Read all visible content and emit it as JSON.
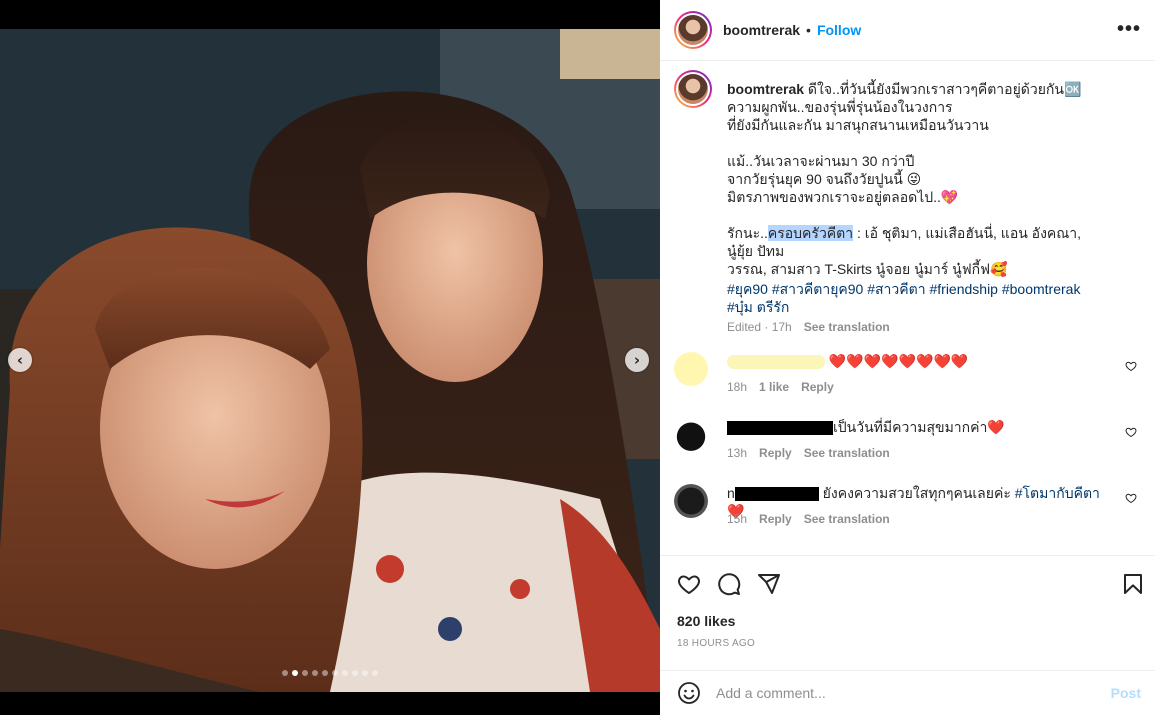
{
  "post": {
    "username": "boomtrerak",
    "separator": "•",
    "follow_label": "Follow",
    "more_label": "•••"
  },
  "media": {
    "prev_label": "‹",
    "next_label": "›",
    "carousel_count": 10,
    "carousel_active_index": 1
  },
  "caption": {
    "username": "boomtrerak",
    "line1": "ดีใจ..ที่วันนี้ยังมีพวกเราสาวๆคีตาอยู่ด้วยกัน🆗",
    "line2": "ความผูกพัน..ของรุ่นพี่รุ่นน้องในวงการ",
    "line3": "ที่ยังมีกันและกัน มาสนุกสนานเหมือนวันวาน",
    "line4": "แม้..วันเวลาจะผ่านมา 30 กว่าปี",
    "line5": "จากวัยรุ่นยุค 90 จนถึงวัยปูนนี้ 😜",
    "line6": "มิตรภาพของพวกเราจะอยู่ตลอดไป..💖",
    "line7_prefix": "รักนะ..",
    "line7_highlight": "ครอบครัวคีตา",
    "line7_suffix": " : เอ้ ชุติมา, แม่เสือฮันนี่, แอน อังคณา, นู๋ยุ้ย ปัทม",
    "line8": "วรรณ, สามสาว T-Skirts นู๋จอย นู๋มาร์ นู๋ฟกี้ฟ🥰",
    "hashtags": "#ยุค90 #สาวคีตายุค90 #สาวคีตา #friendship #boomtrerak #บุ๋ม ตรีรัก",
    "edited": "Edited · 17h",
    "see_translation": "See translation"
  },
  "comments": [
    {
      "text": "❤️❤️❤️❤️❤️❤️❤️❤️",
      "time": "18h",
      "likes": "1 like",
      "reply": "Reply"
    },
    {
      "text": "เป็นวันที่มีความสุขมากค่า❤️",
      "time": "13h",
      "reply": "Reply",
      "see_translation": "See translation"
    },
    {
      "name_initial": "n",
      "text": " ยังคงความสวยใสทุกๆคนเลยค่ะ ",
      "tag": "#โตมากับคีตา",
      "tail": "❤️",
      "time": "15h",
      "reply": "Reply",
      "see_translation": "See translation"
    }
  ],
  "stats": {
    "likes": "820 likes",
    "time_ago": "18 HOURS AGO"
  },
  "add_comment": {
    "placeholder": "Add a comment...",
    "post_label": "Post"
  },
  "colors": {
    "accent": "#0095f6",
    "hashtag": "#00376b",
    "muted": "#8e8e8e",
    "post_disabled": "#b2dffc",
    "highlight": "#b4d5fe"
  }
}
